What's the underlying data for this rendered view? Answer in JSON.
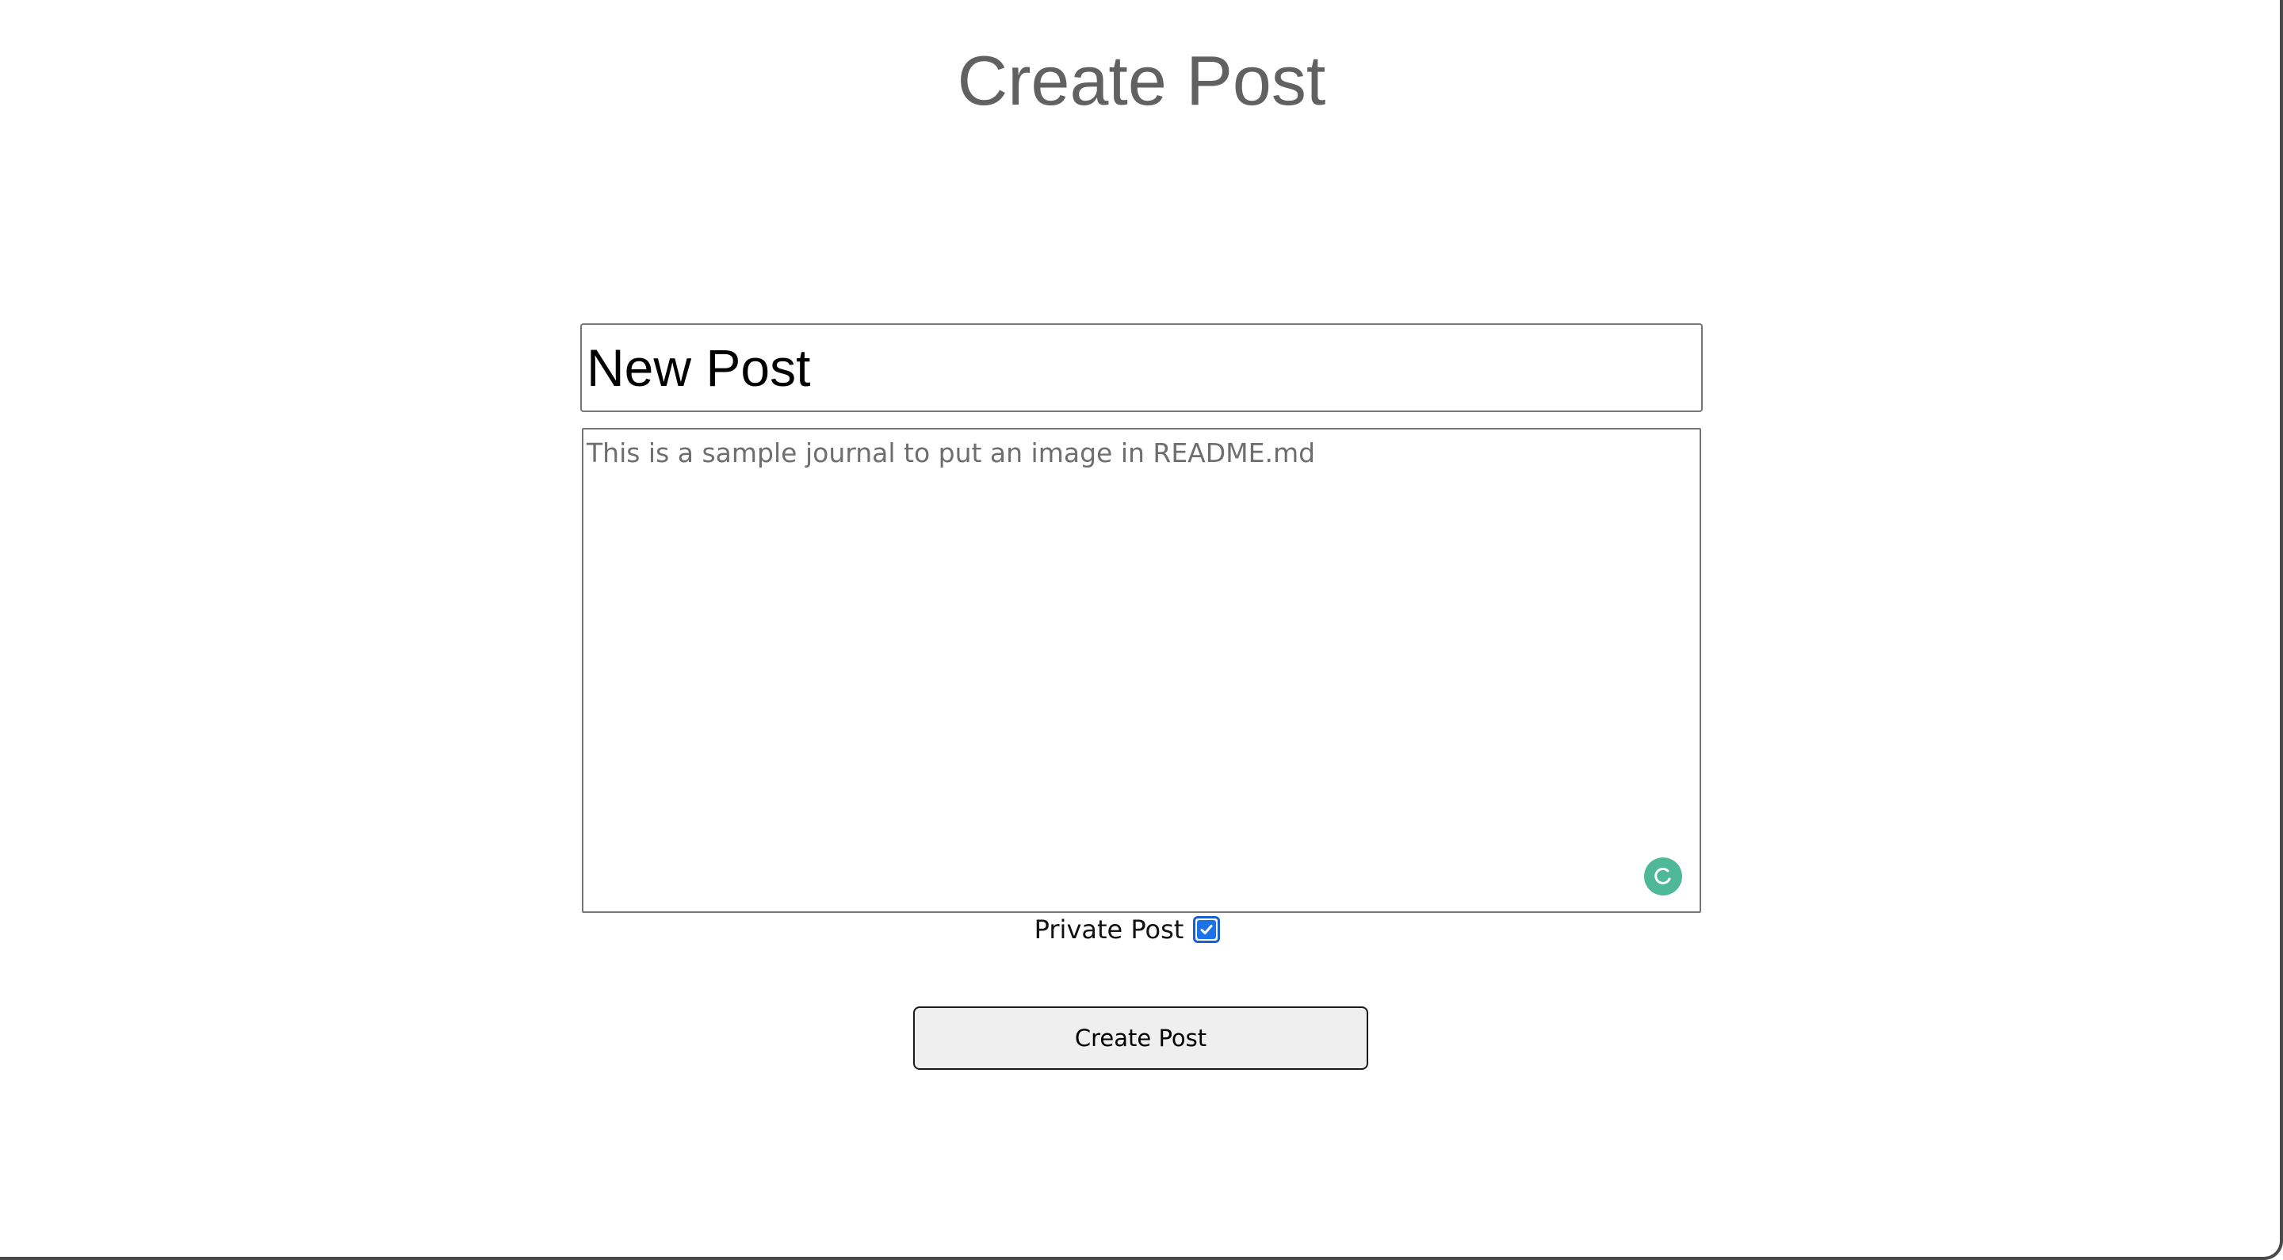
{
  "page": {
    "title": "Create Post"
  },
  "form": {
    "title_value": "New Post",
    "body_placeholder": "This is a sample journal to put an image in README.md",
    "body_value": "",
    "private_label": "Private Post",
    "private_checked": true,
    "submit_label": "Create Post",
    "assist_icon": "grammarly-icon"
  },
  "colors": {
    "title_text": "#616161",
    "assist_badge": "#4fb896",
    "checkbox_accent": "#1a73e8",
    "button_background": "#efefef"
  }
}
